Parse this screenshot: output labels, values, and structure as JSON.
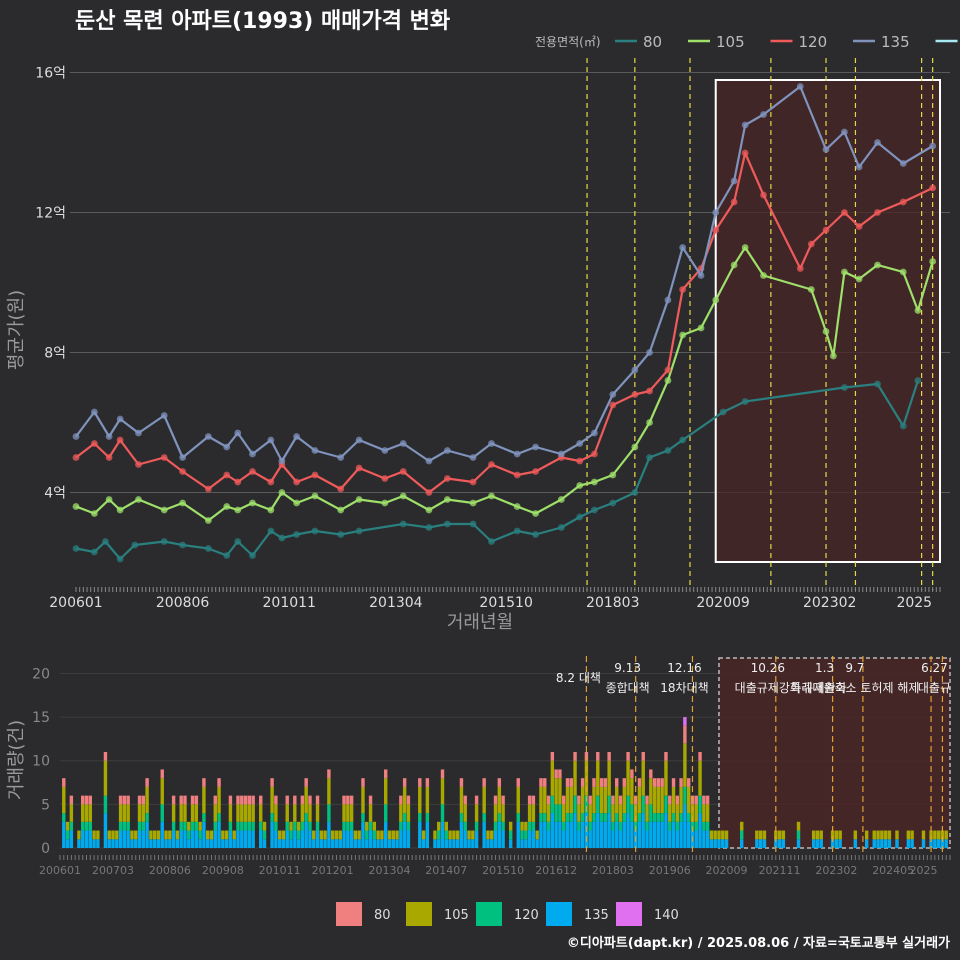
{
  "title": "둔산 목련 아파트(1993) 매매가격 변화",
  "source": "©디아파트(dapt.kr) / 2025.08.06 / 자료=국토교통부 실거래가",
  "colors": {
    "background": "#2b2b2d",
    "grid": "#5a5a5a",
    "event_line": "#e6d84a",
    "event_line_bar": "#e0a030",
    "highlight_fill": "#4a2626",
    "line_80": "#2a7f7f",
    "line_105": "#9ee06a",
    "line_120": "#ef5a5a",
    "line_135": "#7f93bd",
    "line_140": "#a8e8f0",
    "bar_80": "#f08080",
    "bar_105": "#a8a800",
    "bar_120": "#00c080",
    "bar_135": "#00aaee",
    "bar_140": "#e070f0"
  },
  "chart_data": [
    {
      "type": "line",
      "title": "둔산 목련 아파트(1993) 매매가격 변화",
      "xlabel": "거래년월",
      "ylabel": "평균가(원)",
      "legend_title": "전용면적(㎡)",
      "legend_position": "top-right",
      "x_tick_labels": [
        "200601",
        "200806",
        "201011",
        "201304",
        "201510",
        "201803",
        "202009",
        "202302",
        "2025"
      ],
      "y_tick_labels": [
        "4억",
        "8억",
        "12억",
        "16억"
      ],
      "ylim": [
        1.5,
        16.5
      ],
      "y_unit": "억",
      "grid": true,
      "event_dates": [
        "2017-08",
        "2018-09",
        "2019-12",
        "2021-10",
        "2023-01",
        "2023-09",
        "2025-03",
        "2025-06"
      ],
      "highlight_range": [
        "2020-07",
        "2025-08"
      ],
      "series": [
        {
          "name": "80",
          "points": [
            [
              "2006-01",
              2.4
            ],
            [
              "2006-06",
              2.3
            ],
            [
              "2006-09",
              2.6
            ],
            [
              "2007-01",
              2.1
            ],
            [
              "2007-05",
              2.5
            ],
            [
              "2008-01",
              2.6
            ],
            [
              "2008-06",
              2.5
            ],
            [
              "2009-01",
              2.4
            ],
            [
              "2009-06",
              2.2
            ],
            [
              "2009-09",
              2.6
            ],
            [
              "2010-01",
              2.2
            ],
            [
              "2010-06",
              2.9
            ],
            [
              "2010-09",
              2.7
            ],
            [
              "2011-01",
              2.8
            ],
            [
              "2011-06",
              2.9
            ],
            [
              "2012-01",
              2.8
            ],
            [
              "2012-06",
              2.9
            ],
            [
              "2013-06",
              3.1
            ],
            [
              "2014-01",
              3.0
            ],
            [
              "2014-06",
              3.1
            ],
            [
              "2015-01",
              3.1
            ],
            [
              "2015-06",
              2.6
            ],
            [
              "2016-01",
              2.9
            ],
            [
              "2016-06",
              2.8
            ],
            [
              "2017-01",
              3.0
            ],
            [
              "2017-06",
              3.3
            ],
            [
              "2017-10",
              3.5
            ],
            [
              "2018-03",
              3.7
            ],
            [
              "2018-09",
              4.0
            ],
            [
              "2019-01",
              5.0
            ],
            [
              "2019-06",
              5.2
            ],
            [
              "2019-10",
              5.5
            ],
            [
              "2020-09",
              6.3
            ],
            [
              "2021-03",
              6.6
            ],
            [
              "2023-06",
              7.0
            ],
            [
              "2024-03",
              7.1
            ],
            [
              "2024-10",
              5.9
            ],
            [
              "2025-02",
              7.2
            ]
          ]
        },
        {
          "name": "105",
          "points": [
            [
              "2006-01",
              3.6
            ],
            [
              "2006-06",
              3.4
            ],
            [
              "2006-10",
              3.8
            ],
            [
              "2007-01",
              3.5
            ],
            [
              "2007-06",
              3.8
            ],
            [
              "2008-01",
              3.5
            ],
            [
              "2008-06",
              3.7
            ],
            [
              "2009-01",
              3.2
            ],
            [
              "2009-06",
              3.6
            ],
            [
              "2009-09",
              3.5
            ],
            [
              "2010-01",
              3.7
            ],
            [
              "2010-06",
              3.5
            ],
            [
              "2010-09",
              4.0
            ],
            [
              "2011-01",
              3.7
            ],
            [
              "2011-06",
              3.9
            ],
            [
              "2012-01",
              3.5
            ],
            [
              "2012-06",
              3.8
            ],
            [
              "2013-01",
              3.7
            ],
            [
              "2013-06",
              3.9
            ],
            [
              "2014-01",
              3.5
            ],
            [
              "2014-06",
              3.8
            ],
            [
              "2015-01",
              3.7
            ],
            [
              "2015-06",
              3.9
            ],
            [
              "2016-01",
              3.6
            ],
            [
              "2016-06",
              3.4
            ],
            [
              "2017-01",
              3.8
            ],
            [
              "2017-06",
              4.2
            ],
            [
              "2017-10",
              4.3
            ],
            [
              "2018-03",
              4.5
            ],
            [
              "2018-09",
              5.3
            ],
            [
              "2019-01",
              6.0
            ],
            [
              "2019-06",
              7.2
            ],
            [
              "2019-10",
              8.5
            ],
            [
              "2020-03",
              8.7
            ],
            [
              "2020-07",
              9.5
            ],
            [
              "2020-12",
              10.5
            ],
            [
              "2021-03",
              11.0
            ],
            [
              "2021-08",
              10.2
            ],
            [
              "2022-09",
              9.8
            ],
            [
              "2023-01",
              8.6
            ],
            [
              "2023-03",
              7.9
            ],
            [
              "2023-06",
              10.3
            ],
            [
              "2023-10",
              10.1
            ],
            [
              "2024-03",
              10.5
            ],
            [
              "2024-10",
              10.3
            ],
            [
              "2025-02",
              9.2
            ],
            [
              "2025-06",
              10.6
            ]
          ]
        },
        {
          "name": "120",
          "points": [
            [
              "2006-01",
              5.0
            ],
            [
              "2006-06",
              5.4
            ],
            [
              "2006-10",
              5.0
            ],
            [
              "2007-01",
              5.5
            ],
            [
              "2007-06",
              4.8
            ],
            [
              "2008-01",
              5.0
            ],
            [
              "2008-06",
              4.6
            ],
            [
              "2009-01",
              4.1
            ],
            [
              "2009-06",
              4.5
            ],
            [
              "2009-09",
              4.3
            ],
            [
              "2010-01",
              4.6
            ],
            [
              "2010-06",
              4.3
            ],
            [
              "2010-09",
              4.8
            ],
            [
              "2011-01",
              4.3
            ],
            [
              "2011-06",
              4.5
            ],
            [
              "2012-01",
              4.1
            ],
            [
              "2012-06",
              4.7
            ],
            [
              "2013-01",
              4.4
            ],
            [
              "2013-06",
              4.6
            ],
            [
              "2014-01",
              4.0
            ],
            [
              "2014-06",
              4.4
            ],
            [
              "2015-01",
              4.3
            ],
            [
              "2015-06",
              4.8
            ],
            [
              "2016-01",
              4.5
            ],
            [
              "2016-06",
              4.6
            ],
            [
              "2017-01",
              5.0
            ],
            [
              "2017-06",
              4.9
            ],
            [
              "2017-10",
              5.1
            ],
            [
              "2018-03",
              6.5
            ],
            [
              "2018-09",
              6.8
            ],
            [
              "2019-01",
              6.9
            ],
            [
              "2019-06",
              7.5
            ],
            [
              "2019-10",
              9.8
            ],
            [
              "2020-03",
              10.4
            ],
            [
              "2020-07",
              11.5
            ],
            [
              "2020-12",
              12.3
            ],
            [
              "2021-03",
              13.7
            ],
            [
              "2021-08",
              12.5
            ],
            [
              "2022-06",
              10.4
            ],
            [
              "2022-09",
              11.1
            ],
            [
              "2023-01",
              11.5
            ],
            [
              "2023-06",
              12.0
            ],
            [
              "2023-10",
              11.6
            ],
            [
              "2024-03",
              12.0
            ],
            [
              "2024-10",
              12.3
            ],
            [
              "2025-06",
              12.7
            ]
          ]
        },
        {
          "name": "135",
          "points": [
            [
              "2006-01",
              5.6
            ],
            [
              "2006-06",
              6.3
            ],
            [
              "2006-10",
              5.6
            ],
            [
              "2007-01",
              6.1
            ],
            [
              "2007-06",
              5.7
            ],
            [
              "2008-01",
              6.2
            ],
            [
              "2008-06",
              5.0
            ],
            [
              "2009-01",
              5.6
            ],
            [
              "2009-06",
              5.3
            ],
            [
              "2009-09",
              5.7
            ],
            [
              "2010-01",
              5.1
            ],
            [
              "2010-06",
              5.5
            ],
            [
              "2010-09",
              4.9
            ],
            [
              "2011-01",
              5.6
            ],
            [
              "2011-06",
              5.2
            ],
            [
              "2012-01",
              5.0
            ],
            [
              "2012-06",
              5.5
            ],
            [
              "2013-01",
              5.2
            ],
            [
              "2013-06",
              5.4
            ],
            [
              "2014-01",
              4.9
            ],
            [
              "2014-06",
              5.2
            ],
            [
              "2015-01",
              5.0
            ],
            [
              "2015-06",
              5.4
            ],
            [
              "2016-01",
              5.1
            ],
            [
              "2016-06",
              5.3
            ],
            [
              "2017-01",
              5.1
            ],
            [
              "2017-06",
              5.4
            ],
            [
              "2017-10",
              5.7
            ],
            [
              "2018-03",
              6.8
            ],
            [
              "2018-09",
              7.5
            ],
            [
              "2019-01",
              8.0
            ],
            [
              "2019-06",
              9.5
            ],
            [
              "2019-10",
              11.0
            ],
            [
              "2020-03",
              10.2
            ],
            [
              "2020-07",
              12.0
            ],
            [
              "2020-12",
              12.9
            ],
            [
              "2021-03",
              14.5
            ],
            [
              "2021-08",
              14.8
            ],
            [
              "2022-06",
              15.6
            ],
            [
              "2023-01",
              13.8
            ],
            [
              "2023-06",
              14.3
            ],
            [
              "2023-10",
              13.3
            ],
            [
              "2024-03",
              14.0
            ],
            [
              "2024-10",
              13.4
            ],
            [
              "2025-06",
              13.9
            ]
          ]
        },
        {
          "name": "140",
          "points": []
        }
      ]
    },
    {
      "type": "bar",
      "stacked": true,
      "ylabel": "거래량(건)",
      "ylim": [
        0,
        22
      ],
      "y_tick_labels": [
        "0",
        "5",
        "10",
        "15",
        "20"
      ],
      "x_tick_labels": [
        "200601",
        "200703",
        "200806",
        "200908",
        "201011",
        "201201",
        "201304",
        "201407",
        "201510",
        "201612",
        "201803",
        "201906",
        "202009",
        "202111",
        "202302",
        "202405",
        "2025"
      ],
      "series_names": [
        "80",
        "105",
        "120",
        "135",
        "140"
      ],
      "legend_position": "bottom",
      "annotations": [
        {
          "date": "2017-08",
          "label": "8.2 대책"
        },
        {
          "date": "2018-09",
          "label": "9.13"
        },
        {
          "date": "2018-09",
          "label": "종합대책"
        },
        {
          "date": "2019-12",
          "label": "12.16"
        },
        {
          "date": "2019-12",
          "label": "18차대책"
        },
        {
          "date": "2021-10",
          "label": "10.26"
        },
        {
          "date": "2021-10",
          "label": "대출규제강화"
        },
        {
          "date": "2023-01",
          "label": "1.3"
        },
        {
          "date": "2023-01",
          "label": "규제완화"
        },
        {
          "date": "2023-09",
          "label": "9.7"
        },
        {
          "date": "2023-09",
          "label": "특례대출축소 토허제 해제"
        },
        {
          "date": "2025-06",
          "label": "6.27"
        },
        {
          "date": "2025-06",
          "label": "대출규"
        }
      ],
      "event_dates": [
        "2017-08",
        "2018-09",
        "2019-12",
        "2021-10",
        "2023-01",
        "2023-09",
        "2025-03",
        "2025-06"
      ],
      "highlight_range": [
        "2020-07",
        "2025-08"
      ]
    }
  ]
}
